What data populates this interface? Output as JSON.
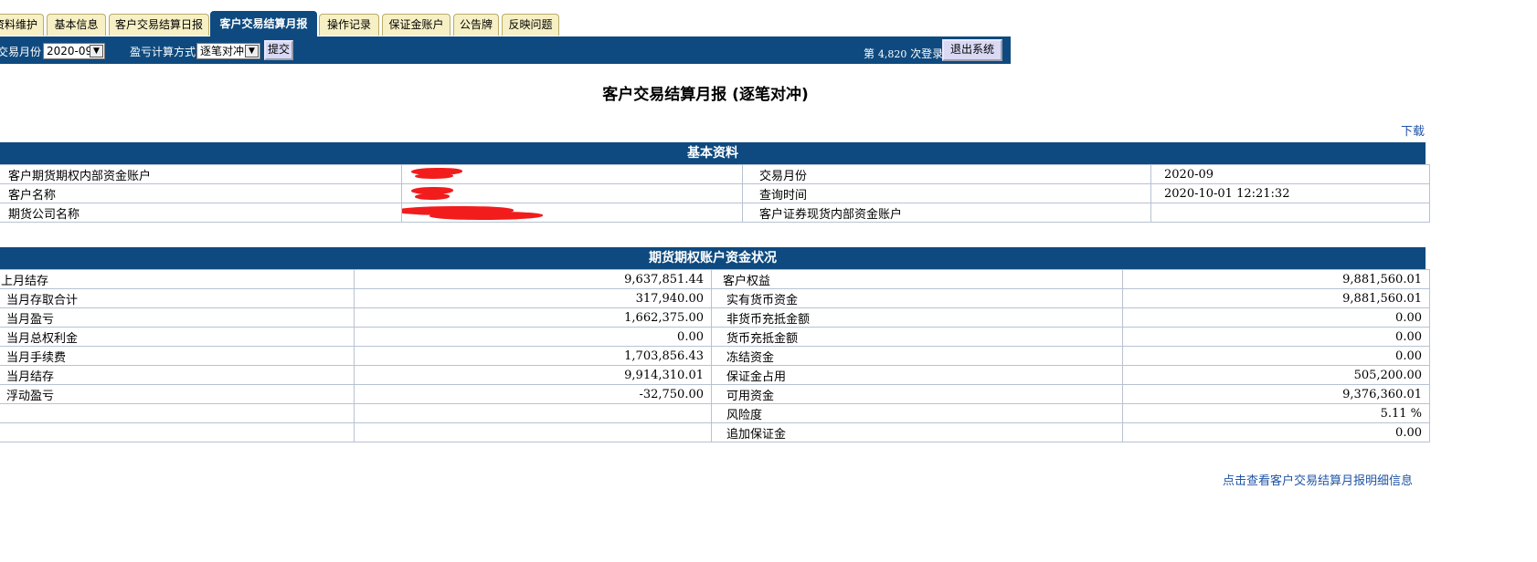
{
  "tabs": [
    {
      "label": "资料维护",
      "active": false
    },
    {
      "label": "基本信息",
      "active": false
    },
    {
      "label": "客户交易结算日报",
      "active": false
    },
    {
      "label": "客户交易结算月报",
      "active": true
    },
    {
      "label": "操作记录",
      "active": false
    },
    {
      "label": "保证金账户",
      "active": false
    },
    {
      "label": "公告牌",
      "active": false
    },
    {
      "label": "反映问题",
      "active": false
    }
  ],
  "toolbar": {
    "month_label": "交易月份",
    "month_value": "2020-09",
    "calc_label": "盈亏计算方式",
    "calc_value": "逐笔对冲",
    "submit_label": "提交",
    "login_prefix": "第",
    "login_count": "4,820",
    "login_suffix": "次登录",
    "logout_label": "退出系统"
  },
  "page_title": "客户交易结算月报 (逐笔对冲)",
  "download_label": "下载",
  "basic": {
    "title": "基本资料",
    "rows": [
      {
        "l1": "客户期货期权内部资金账户",
        "v1": "",
        "l2": "交易月份",
        "v2": "2020-09"
      },
      {
        "l1": "客户名称",
        "v1": "",
        "l2": "查询时间",
        "v2": "2020-10-01 12:21:32"
      },
      {
        "l1": "期货公司名称",
        "v1": "",
        "l2": "客户证券现货内部资金账户",
        "v2": ""
      }
    ]
  },
  "funds": {
    "title": "期货期权账户资金状况",
    "rows": [
      {
        "l1": "上月结存",
        "v1": "9,637,851.44",
        "l2": "客户权益",
        "v2": "9,881,560.01"
      },
      {
        "l1": "当月存取合计",
        "v1": "317,940.00",
        "l2": "实有货币资金",
        "v2": "9,881,560.01"
      },
      {
        "l1": "当月盈亏",
        "v1": "1,662,375.00",
        "l2": "非货币充抵金额",
        "v2": "0.00"
      },
      {
        "l1": "当月总权利金",
        "v1": "0.00",
        "l2": "货币充抵金额",
        "v2": "0.00"
      },
      {
        "l1": "当月手续费",
        "v1": "1,703,856.43",
        "l2": "冻结资金",
        "v2": "0.00"
      },
      {
        "l1": "当月结存",
        "v1": "9,914,310.01",
        "l2": "保证金占用",
        "v2": "505,200.00"
      },
      {
        "l1": "浮动盈亏",
        "v1": "-32,750.00",
        "l2": "可用资金",
        "v2": "9,376,360.01"
      },
      {
        "l1": "",
        "v1": "",
        "l2": "风险度",
        "v2": "5.11 %"
      },
      {
        "l1": "",
        "v1": "",
        "l2": "追加保证金",
        "v2": "0.00"
      }
    ]
  },
  "detail_link": "点击查看客户交易结算月报明细信息",
  "colors": {
    "header_bg": "#0e4a7f",
    "tab_bg": "#f7f0c4",
    "link": "#1f55a5",
    "redaction": "#f21c1c"
  }
}
